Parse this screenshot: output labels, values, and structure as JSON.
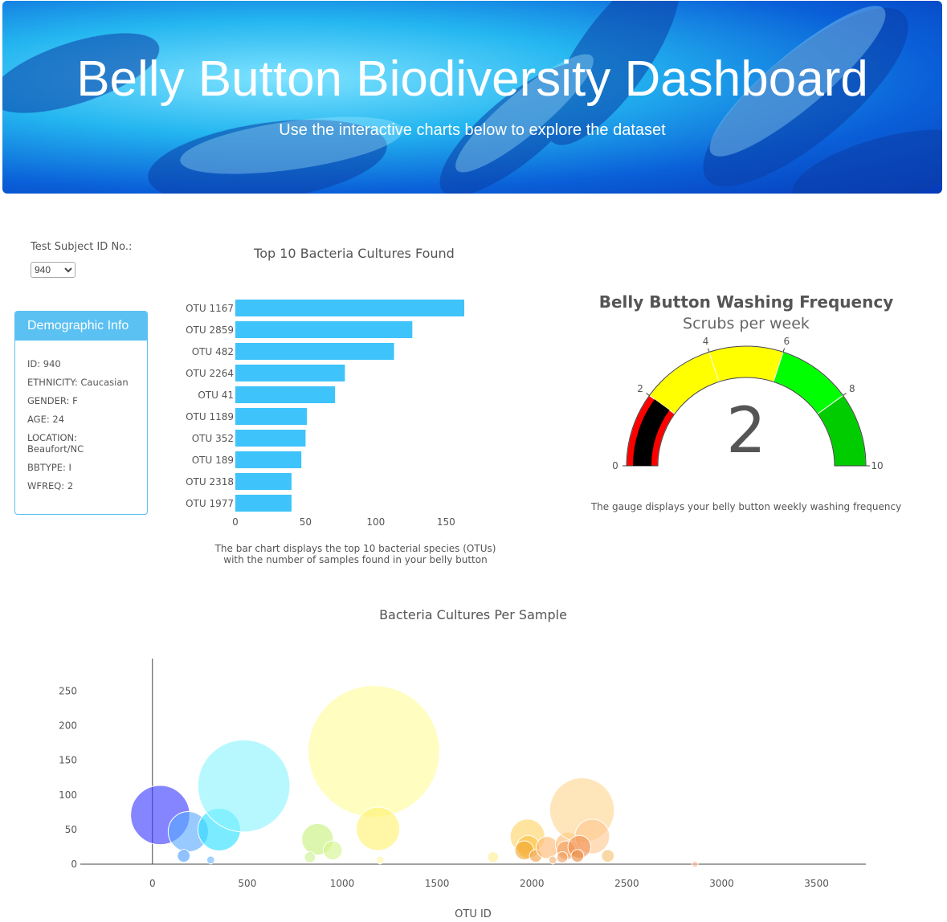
{
  "header": {
    "title": "Belly Button Biodiversity Dashboard",
    "subtitle": "Use the interactive charts below to explore the dataset"
  },
  "selector": {
    "label": "Test Subject ID No.:",
    "value": "940"
  },
  "demographics": {
    "title": "Demographic Info",
    "rows": [
      "ID: 940",
      "ETHNICITY: Caucasian",
      "GENDER: F",
      "AGE: 24",
      "LOCATION: Beaufort/NC",
      "BBTYPE: I",
      "WFREQ: 2"
    ]
  },
  "bar_caption": [
    "The bar chart displays the top 10 bacterial species (OTUs)",
    "with the number of samples found in your belly button"
  ],
  "gauge_caption": "The gauge displays your belly button weekly washing frequency",
  "chart_data": [
    {
      "type": "bar",
      "orientation": "horizontal",
      "title": "Top 10 Bacteria Cultures Found",
      "categories": [
        "OTU 1167",
        "OTU 2859",
        "OTU 482",
        "OTU 2264",
        "OTU 41",
        "OTU 1189",
        "OTU 352",
        "OTU 189",
        "OTU 2318",
        "OTU 1977"
      ],
      "values": [
        163,
        126,
        113,
        78,
        71,
        51,
        50,
        47,
        40,
        40
      ],
      "xticks": [
        0,
        50,
        100,
        150
      ],
      "xlim": [
        0,
        171
      ],
      "color": "#3ec3fa"
    },
    {
      "type": "gauge",
      "title": "Belly Button Washing Frequency",
      "subtitle": "Scrubs per week",
      "value": 2,
      "range": [
        0,
        10
      ],
      "tick_labels": [
        "0",
        "2",
        "4",
        "6",
        "8",
        "10"
      ],
      "bands": [
        {
          "from": 0,
          "to": 2,
          "color": "#ff0000"
        },
        {
          "from": 2,
          "to": 4,
          "color": "#ffff00"
        },
        {
          "from": 4,
          "to": 6,
          "color": "#ffff00"
        },
        {
          "from": 6,
          "to": 8,
          "color": "#00ff00"
        },
        {
          "from": 8,
          "to": 10,
          "color": "#00cc00"
        }
      ],
      "bar_color": "#000000"
    },
    {
      "type": "scatter",
      "title": "Bacteria Cultures Per Sample",
      "xlabel": "OTU ID",
      "xticks": [
        0,
        500,
        1000,
        1500,
        2000,
        2500,
        3000,
        3500
      ],
      "yticks": [
        0,
        50,
        100,
        150,
        200,
        250
      ],
      "xlim": [
        -380,
        3760
      ],
      "ylim": [
        0,
        297
      ],
      "points": [
        {
          "x": 41,
          "y": 71,
          "r": 71,
          "color": "#3a3aff"
        },
        {
          "x": 189,
          "y": 47,
          "r": 47,
          "color": "#5aaaff"
        },
        {
          "x": 352,
          "y": 50,
          "r": 50,
          "color": "#2ae0ff"
        },
        {
          "x": 482,
          "y": 113,
          "r": 113,
          "color": "#8af4ff"
        },
        {
          "x": 165,
          "y": 12,
          "r": 12,
          "color": "#4a9cff"
        },
        {
          "x": 307,
          "y": 6,
          "r": 6,
          "color": "#6ab6ff"
        },
        {
          "x": 870,
          "y": 36,
          "r": 36,
          "color": "#c8f07a"
        },
        {
          "x": 950,
          "y": 20,
          "r": 20,
          "color": "#d4f58a"
        },
        {
          "x": 830,
          "y": 10,
          "r": 10,
          "color": "#ccf090"
        },
        {
          "x": 1167,
          "y": 163,
          "r": 163,
          "color": "#fffb9a"
        },
        {
          "x": 1189,
          "y": 51,
          "r": 51,
          "color": "#fff170"
        },
        {
          "x": 1200,
          "y": 6,
          "r": 6,
          "color": "#fff7a6"
        },
        {
          "x": 1795,
          "y": 10,
          "r": 10,
          "color": "#ffee90"
        },
        {
          "x": 1977,
          "y": 40,
          "r": 40,
          "color": "#ffd466"
        },
        {
          "x": 1980,
          "y": 25,
          "r": 25,
          "color": "#ffc040"
        },
        {
          "x": 1960,
          "y": 20,
          "r": 20,
          "color": "#f2a830"
        },
        {
          "x": 2020,
          "y": 12,
          "r": 12,
          "color": "#f0a040"
        },
        {
          "x": 2080,
          "y": 24,
          "r": 24,
          "color": "#ffb870"
        },
        {
          "x": 2190,
          "y": 28,
          "r": 28,
          "color": "#ffba70"
        },
        {
          "x": 2180,
          "y": 20,
          "r": 20,
          "color": "#f0a060"
        },
        {
          "x": 2264,
          "y": 78,
          "r": 78,
          "color": "#ffd590"
        },
        {
          "x": 2318,
          "y": 40,
          "r": 40,
          "color": "#ffc890"
        },
        {
          "x": 2250,
          "y": 25,
          "r": 25,
          "color": "#f09050"
        },
        {
          "x": 2160,
          "y": 10,
          "r": 10,
          "color": "#f0a060"
        },
        {
          "x": 2240,
          "y": 12,
          "r": 12,
          "color": "#e88a40"
        },
        {
          "x": 2110,
          "y": 6,
          "r": 6,
          "color": "#f0b070"
        },
        {
          "x": 2400,
          "y": 12,
          "r": 12,
          "color": "#f5c070"
        },
        {
          "x": 2859,
          "y": 0,
          "r": 4,
          "color": "#ffc0a0"
        }
      ]
    }
  ]
}
